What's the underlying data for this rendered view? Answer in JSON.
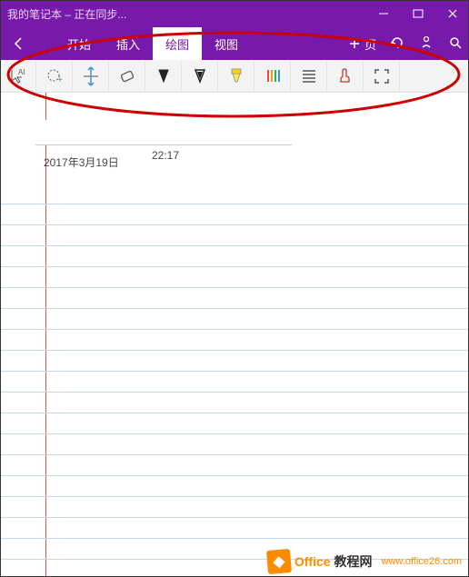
{
  "title": "我的笔记本 – 正在同步...",
  "tabs": {
    "start": "开始",
    "insert": "插入",
    "draw": "绘图",
    "view": "视图"
  },
  "addPage": "页",
  "date": "2017年3月19日",
  "time": "22:17",
  "tools": {
    "textSelect": "text-select",
    "lasso": "lasso-select",
    "insertSpace": "insert-space",
    "eraser": "eraser",
    "penBlack": "pen-black",
    "penOutline": "pen-outline",
    "highlighter": "highlighter-yellow",
    "colorPens": "color-pens",
    "lines": "ruled-lines",
    "touch": "touch-mode",
    "fullscreen": "fullscreen"
  },
  "watermark": {
    "brand1": "Office",
    "brand2": "教程网",
    "url": "www.office26.com"
  }
}
